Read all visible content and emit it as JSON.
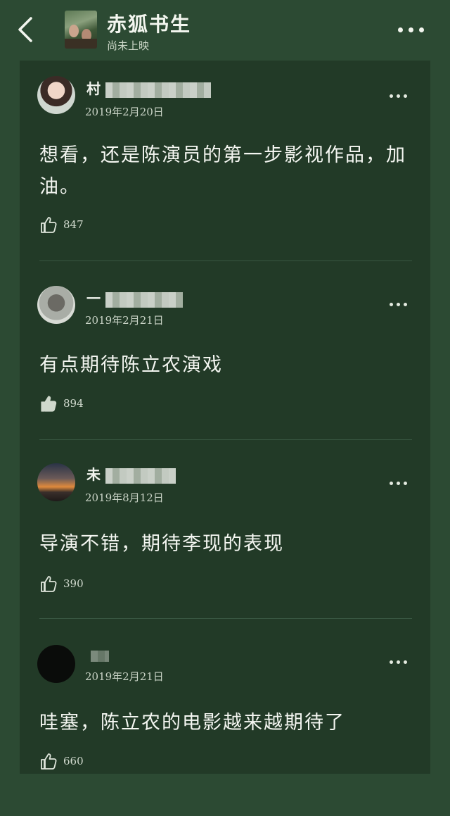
{
  "header": {
    "title": "赤狐书生",
    "subtitle": "尚未上映"
  },
  "comments": [
    {
      "username": "村",
      "date": "2019年2月20日",
      "text": "想看，还是陈演员的第一步影视作品，加油。",
      "likes": "847"
    },
    {
      "username": "一",
      "date": "2019年2月21日",
      "text": "有点期待陈立农演戏",
      "likes": "894"
    },
    {
      "username": "未",
      "date": "2019年8月12日",
      "text": "导演不错，期待李现的表现",
      "likes": "390"
    },
    {
      "username": "",
      "date": "2019年2月21日",
      "text": "哇塞，陈立农的电影越来越期待了",
      "likes": "660"
    }
  ]
}
